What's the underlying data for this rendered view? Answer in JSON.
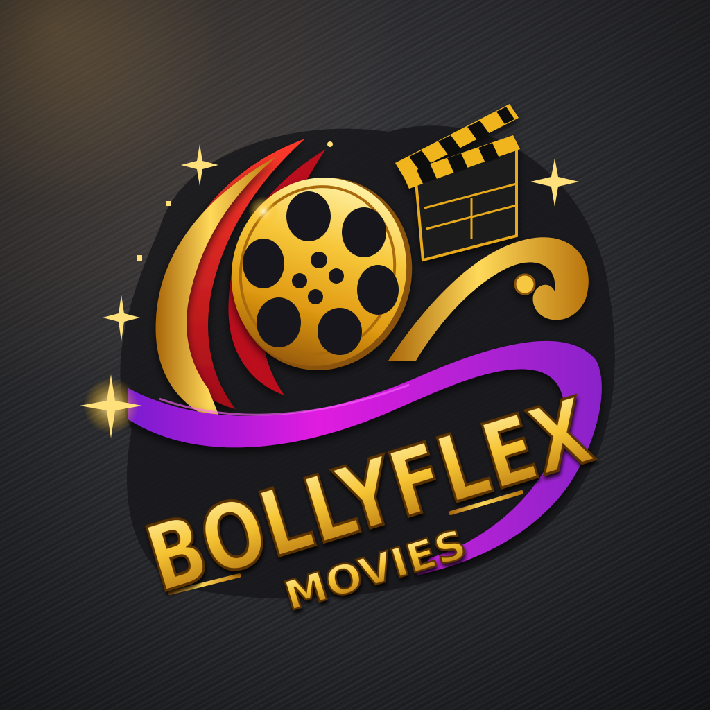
{
  "logo": {
    "brand_name": "BOLLYFLEX",
    "tagline": "MOVIES",
    "colors": {
      "gold_light": "#fff2a6",
      "gold": "#f2b51c",
      "gold_dark": "#9a5d08",
      "red": "#e0161d",
      "magenta": "#d11adb",
      "purple": "#8a22c9",
      "background": "#2b2c30"
    },
    "icons": [
      "film-reel-icon",
      "clapperboard-icon",
      "sparkle-icon",
      "ribbon-swirl"
    ]
  }
}
